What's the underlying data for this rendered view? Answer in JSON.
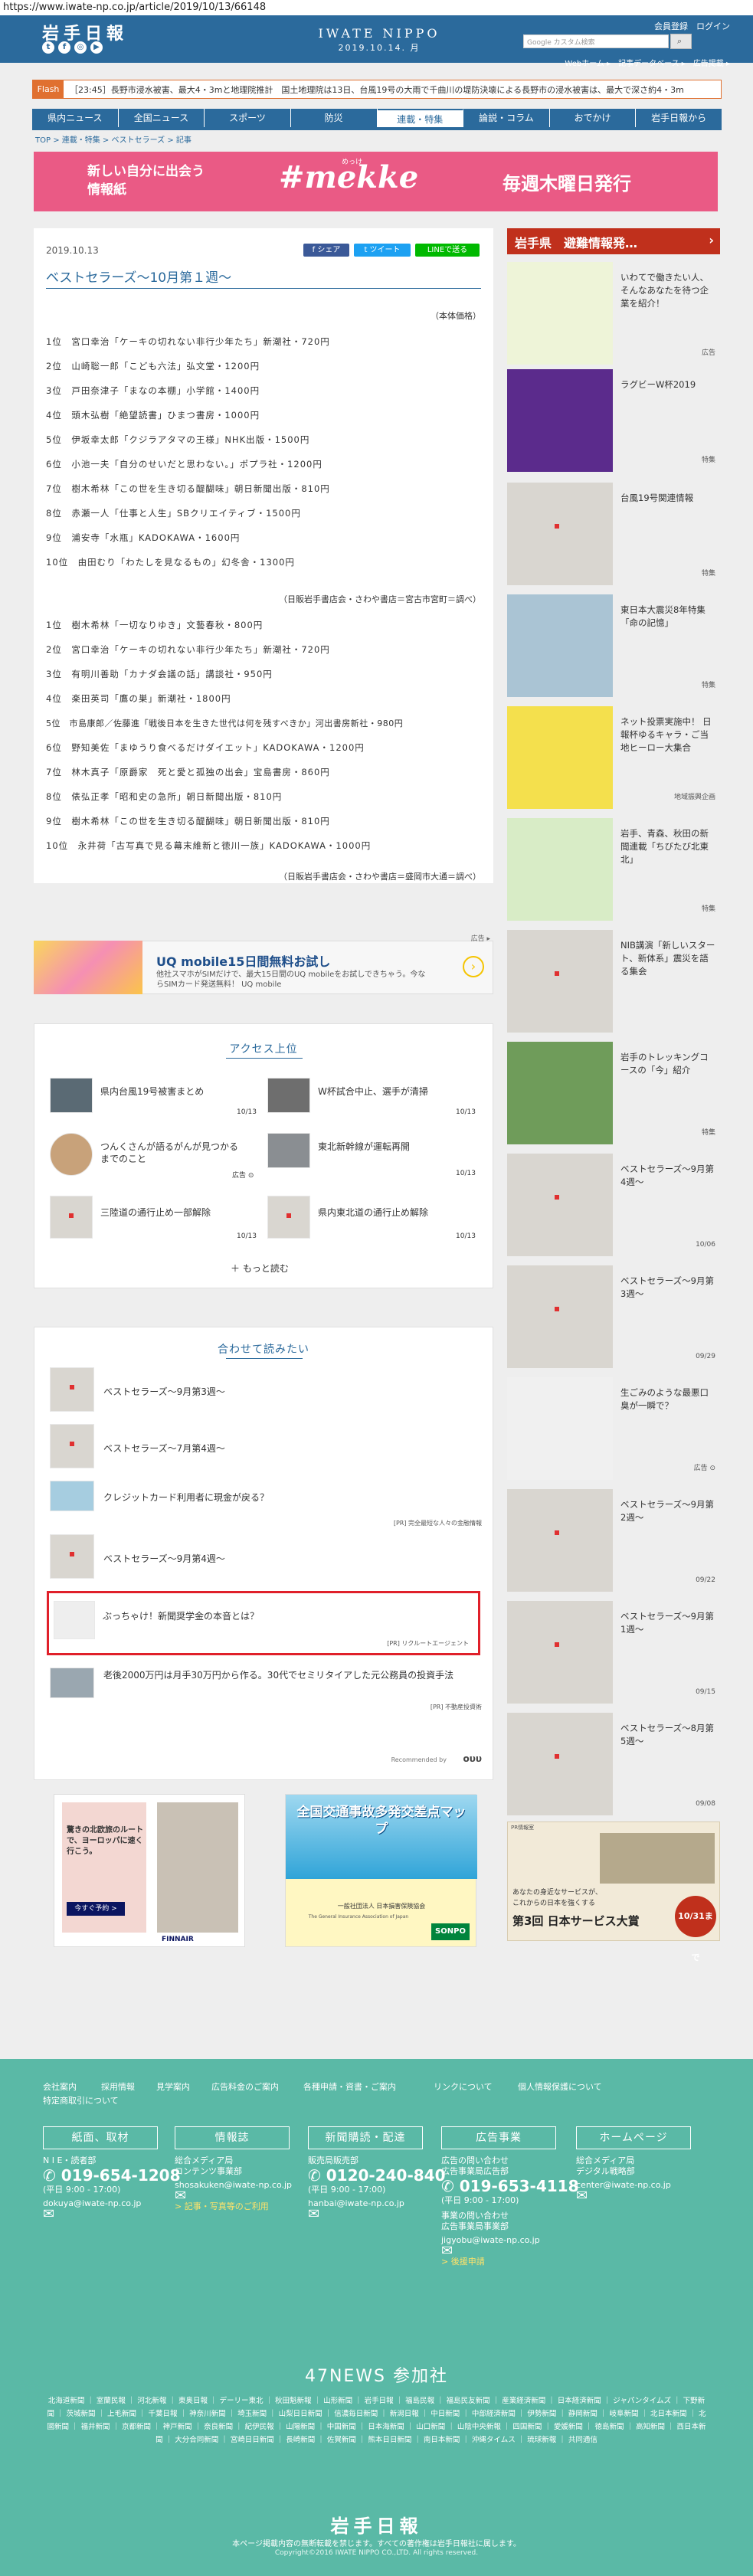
{
  "url": "https://www.iwate-np.co.jp/article/2019/10/13/66148",
  "header": {
    "logo": "岩手日報",
    "title": "IWATE NIPPO",
    "date": "2019.10.14. 月",
    "member_links": "会員登録　ログイン",
    "web_links": "Webホーム ▸　記事データベース ▸　広告掲載 ▸",
    "search_placeholder": "Google カスタム検索"
  },
  "flash": {
    "label": "Flash",
    "text": "［23:45］長野市浸水被害、最大4・3mと地理院推計　国土地理院は13日、台風19号の大雨で千曲川の堤防決壊による長野市の浸水被害は、最大で深さ約4・3m"
  },
  "nav": [
    "県内ニュース",
    "全国ニュース",
    "スポーツ",
    "防災",
    "連載・特集",
    "論説・コラム",
    "おでかけ",
    "岩手日報から"
  ],
  "breadcrumb": "TOP > 連載・特集 > ベストセラーズ > 記事",
  "banner": {
    "left": "新しい自分に出会う\n情報紙",
    "ruby": "めっけ",
    "mid": "#mekke",
    "right": "毎週木曜日発行"
  },
  "article": {
    "date": "2019.10.13",
    "share_fb": "シェア",
    "share_tw": "ツイート",
    "share_line": "LINEで送る",
    "title": "ベストセラーズ〜10月第１週〜",
    "price_note": "（本体価格）",
    "list1": [
      "1位　宮口幸治「ケーキの切れない非行少年たち」新潮社・720円",
      "2位　山崎聡一郎「こども六法」弘文堂・1200円",
      "3位　戸田奈津子「まなの本棚」小学館・1400円",
      "4位　頭木弘樹「絶望読書」ひまつ書房・1000円",
      "5位　伊坂幸太郎「クジラアタマの王様」NHK出版・1500円",
      "6位　小池一夫「自分のせいだと思わない。」ポプラ社・1200円",
      "7位　樹木希林「この世を生き切る醍醐味」朝日新聞出版・810円",
      "8位　赤瀬一人「仕事と人生」SBクリエイティブ・1500円",
      "9位　浦安寺「水瓶」KADOKAWA・1600円",
      "10位　由田むり「わたしを見なるもの」幻冬舎・1300円"
    ],
    "src1": "（日販岩手書店会・さわや書店＝宮古市宮町＝調べ）",
    "list2": [
      "1位　樹木希林「一切なりゆき」文藝春秋・800円",
      "2位　宮口幸治「ケーキの切れない非行少年たち」新潮社・720円",
      "3位　有明川善助「カナダ会議の話」講談社・950円",
      "4位　楽田英司「鷹の巣」新潮社・1800円",
      "5位　市島康郎／佐藤進「戦後日本を生きた世代は何を残すべきか」河出書房新社・980円",
      "6位　野知美佐「まゆうり食べるだけダイエット」KADOKAWA・1200円",
      "7位　林木真子「原爵家　死と愛と孤独の出会」宝島書房・860円",
      "8位　俵弘正孝「昭和史の急所」朝日新聞出版・810円",
      "9位　樹木希林「この世を生き切る醍醐味」朝日新聞出版・810円",
      "10位　永井荷「古写真で見る幕末維新と徳川一族」KADOKAWA・1000円"
    ],
    "src2": "（日販岩手書店会・さわや書店＝盛岡市大通＝調べ）"
  },
  "ad": {
    "label": "広告 ▸",
    "title": "UQ mobile15日間無料お試し",
    "desc": "他社スマホがSIMだけで、最大15日間のUQ mobileをお試しできちゃう。今ならSIMカード発送無料！ UQ mobile"
  },
  "access": {
    "title": "アクセス上位",
    "items": [
      {
        "text": "県内台風19号被害まとめ",
        "date": "10/13"
      },
      {
        "text": "W杯試合中止、選手が清掃",
        "date": "10/13"
      },
      {
        "text": "つんくさんが語るがんが見つかるまでのこと",
        "date": "広告 ⊙"
      },
      {
        "text": "東北新幹線が運転再開",
        "date": "10/13"
      },
      {
        "text": "三陸道の通行止め一部解除",
        "date": "10/13"
      },
      {
        "text": "県内東北道の通行止め解除",
        "date": "10/13"
      }
    ],
    "more": "＋ もっと読む"
  },
  "related": {
    "title": "合わせて読みたい",
    "items": [
      {
        "text": "ベストセラーズ〜9月第3週〜",
        "tag": ""
      },
      {
        "text": "ベストセラーズ〜7月第4週〜",
        "tag": ""
      },
      {
        "text": "クレジットカード利用者に現金が戻る？",
        "tag": "[PR] 完全最短な人々の金融情報"
      },
      {
        "text": "ベストセラーズ〜9月第4週〜",
        "tag": ""
      },
      {
        "text": "ぶっちゃけ！新聞奨学金の本音とは？",
        "tag": "[PR] リクルートエージェント"
      },
      {
        "text": "老後2000万円は月手30万円から作る。30代でセミリタイアした元公務員の投資手法",
        "tag": "[PR] 不動産投資術"
      }
    ],
    "recommended": "Recommended by",
    "recommended_brand": "ουυ"
  },
  "bottom_ads": {
    "left_text": "驚きの北欧旅のルートで、ヨーロッパに速く行こう。",
    "left_button": "今すぐ予約 >",
    "left_brand": "FINNAIR",
    "right_title": "全国交通事故多発交差点マップ",
    "right_sub": "一般社団法人 日本損害保険協会",
    "right_sub2": "The General Insurance Association of Japan",
    "right_brand": "SONPO"
  },
  "sidebar": {
    "head": "岩手県　避難情報発…",
    "items": [
      {
        "text": "いわてで働きたい人、そんなあなたを待つ企業を紹介！",
        "tag": "広告"
      },
      {
        "text": "ラグビーW杯2019",
        "tag": "特集"
      },
      {
        "text": "台風19号関連情報",
        "tag": "特集"
      },
      {
        "text": "東日本大震災8年特集「命の記憶」",
        "tag": "特集"
      },
      {
        "text": "ネット投票実施中！ 日報杯ゆるキャラ・ご当地ヒーロー大集合",
        "tag": "地域振興企画"
      },
      {
        "text": "岩手、青森、秋田の新聞連載「ちびたび北東北」",
        "tag": "特集"
      },
      {
        "text": "NIB講演「新しいスタート、新体系」震災を語る集会",
        "tag": ""
      },
      {
        "text": "岩手のトレッキングコースの「今」紹介",
        "tag": "特集"
      },
      {
        "text": "ベストセラーズ〜9月第4週〜",
        "tag": "10/06"
      },
      {
        "text": "ベストセラーズ〜9月第3週〜",
        "tag": "09/29"
      },
      {
        "text": "生ごみのような最悪口臭が一瞬で？",
        "tag": "広告 ⊙"
      },
      {
        "text": "ベストセラーズ〜9月第2週〜",
        "tag": "09/22"
      },
      {
        "text": "ベストセラーズ〜9月第1週〜",
        "tag": "09/15"
      },
      {
        "text": "ベストセラーズ〜8月第5週〜",
        "tag": "09/08"
      }
    ],
    "service_ad": {
      "tag": "PR情報室",
      "line1": "あなたの身近なサービスが、",
      "line2": "これからの日本を強くする",
      "award": "第3回 日本サービス大賞",
      "deadline": "10/31まで"
    }
  },
  "footer": {
    "top_links": [
      "会社案内",
      "採用情報",
      "見学案内",
      "広告料金のご案内",
      "各種申請・資書・ご案内",
      "リンクについて",
      "個人情報保護について",
      "特定商取引について"
    ],
    "boxes": [
      "紙面、取材",
      "情報誌",
      "新聞購読・配達",
      "広告事業",
      "ホームページ"
    ],
    "col1": {
      "line1": "N I E・読者部",
      "phone": "019-654-1208",
      "hours": "(平日 9:00 - 17:00)",
      "email": "dokuya@iwate-np.co.jp"
    },
    "col2": {
      "line1": "総合メディア局",
      "line2": "コンテンツ事業部",
      "email": "shosakuken@iwate-np.co.jp",
      "link": "> 記事・写真等のご利用"
    },
    "col3": {
      "line1": "販売局販売部",
      "phone": "0120-240-840",
      "hours": "(平日 9:00 - 17:00)",
      "email": "hanbai@iwate-np.co.jp"
    },
    "col4": {
      "line1": "広告の問い合わせ",
      "line2": "広告事業局広告部",
      "phone": "019-653-4118",
      "hours": "(平日 9:00 - 17:00)",
      "line3": "事業の問い合わせ",
      "line4": "広告事業局事業部",
      "email": "jigyobu@iwate-np.co.jp",
      "link": "> 後援申請"
    },
    "col5": {
      "line1": "総合メディア局",
      "line2": "デジタル戦略部",
      "email": "center@iwate-np.co.jp"
    },
    "news47": "47NEWS 参加社",
    "news_list": "北海道新聞 ｜ 室蘭民報 ｜ 河北新報 ｜ 東奥日報 ｜ デーリー東北 ｜ 秋田魁新報 ｜ 山形新聞 ｜ 岩手日報 ｜ 福島民報 ｜ 福島民友新聞 ｜ 産業経済新聞 ｜ 日本経済新聞 ｜ ジャパンタイムズ ｜ 下野新聞 ｜ 茨城新聞 ｜ 上毛新聞 ｜ 千葉日報 ｜ 神奈川新聞 ｜ 埼玉新聞 ｜ 山梨日日新聞 ｜ 信濃毎日新聞 ｜ 新潟日報 ｜ 中日新聞 ｜ 中部経済新聞 ｜ 伊勢新聞 ｜ 静岡新聞 ｜ 岐阜新聞 ｜ 北日本新聞 ｜ 北國新聞 ｜ 福井新聞 ｜ 京都新聞 ｜ 神戸新聞 ｜ 奈良新聞 ｜ 紀伊民報 ｜ 山陽新聞 ｜ 中国新聞 ｜ 日本海新聞 ｜ 山口新聞 ｜ 山陰中央新報 ｜ 四国新聞 ｜ 愛媛新聞 ｜ 徳島新聞 ｜ 高知新聞 ｜ 西日本新聞 ｜ 大分合同新聞 ｜ 宮崎日日新聞 ｜ 長崎新聞 ｜ 佐賀新聞 ｜ 熊本日日新聞 ｜ 南日本新聞 ｜ 沖縄タイムス ｜ 琉球新報 ｜ 共同通信",
    "logo": "岩手日報",
    "note": "本ページ掲載内容の無断転載を禁じます。すべての著作権は岩手日報社に属します。",
    "copy": "Copyright©2016 IWATE NIPPO CO.,LTD. All rights reserved."
  },
  "colors": {
    "brand": "#2b6a9c",
    "footer": "#5ab9a6",
    "banner": "#ea5a85",
    "alert": "#c0301c",
    "highlight": "#e0202a"
  }
}
